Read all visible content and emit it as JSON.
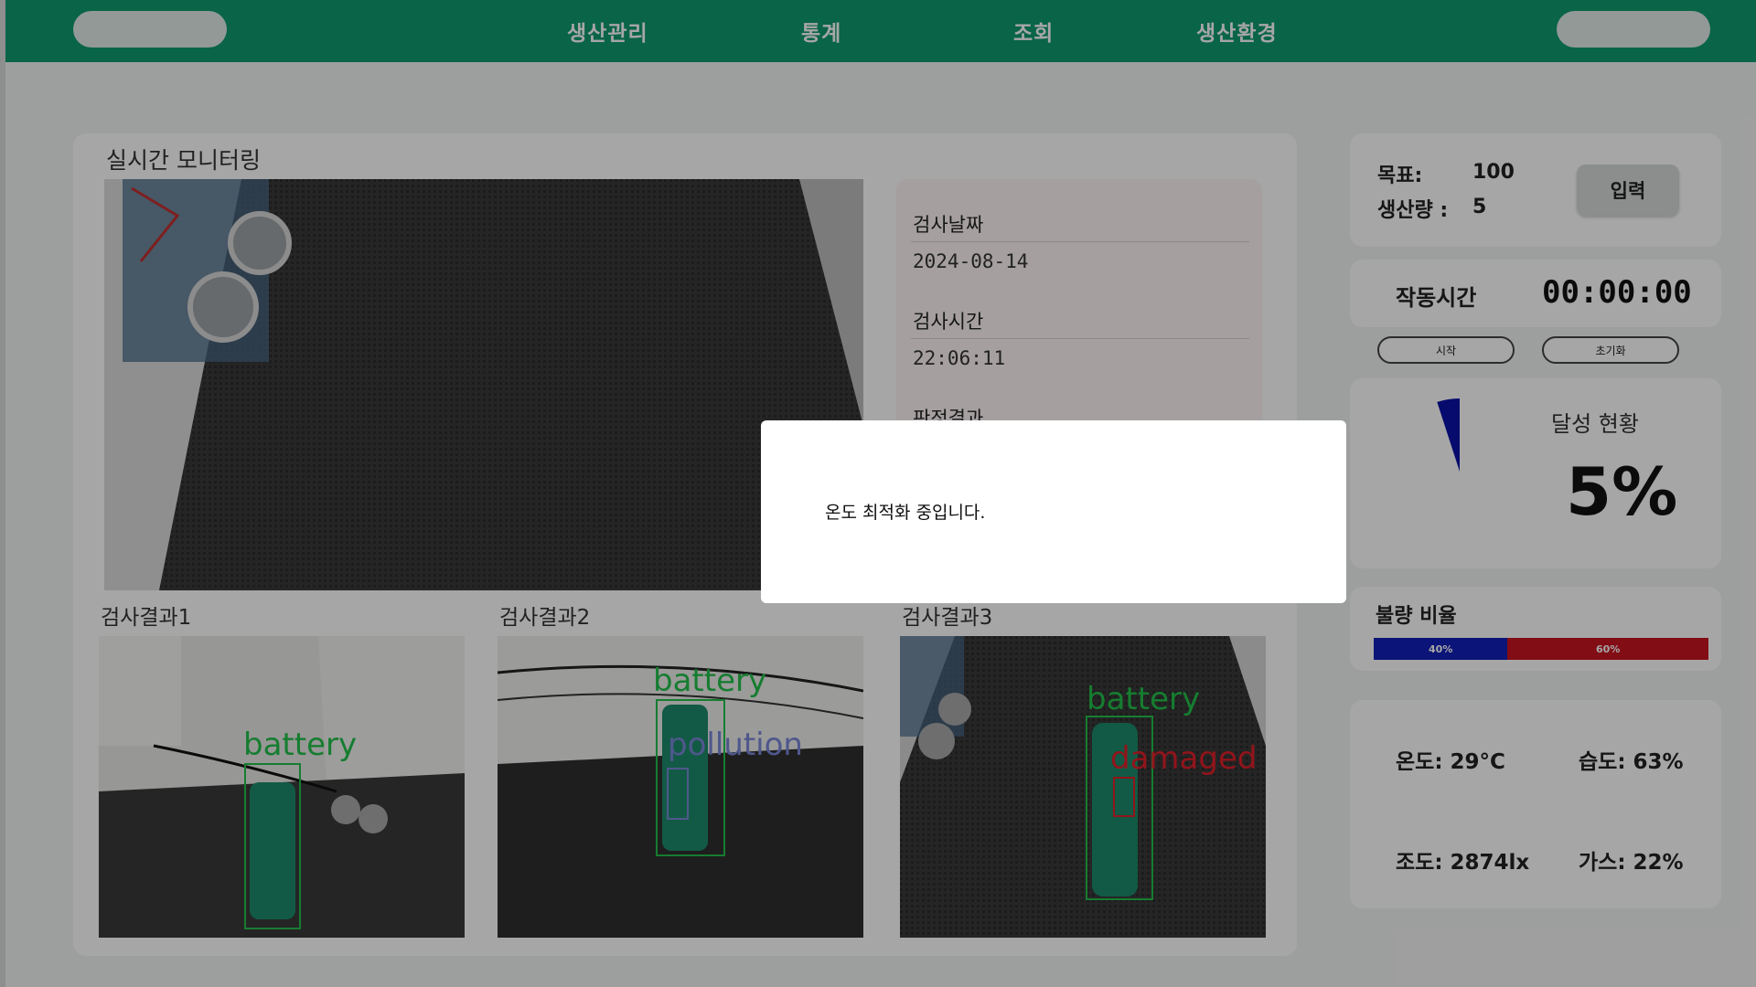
{
  "nav": {
    "items": [
      "생산관리",
      "통계",
      "조회",
      "생산환경"
    ]
  },
  "monitoring": {
    "title": "실시간 모니터링",
    "info": {
      "date_label": "검사날짜",
      "date_value": "2024-08-14",
      "time_label": "검사시간",
      "time_value": "22:06:11",
      "result_label": "판정결과"
    },
    "results": [
      {
        "label": "검사결과1",
        "detections": [
          "battery"
        ]
      },
      {
        "label": "검사결과2",
        "detections": [
          "battery",
          "pollution"
        ]
      },
      {
        "label": "검사결과3",
        "detections": [
          "battery",
          "damaged"
        ]
      }
    ]
  },
  "goal": {
    "target_label": "목표:",
    "target_value": "100",
    "produced_label": "생산량 :",
    "produced_value": "5",
    "input_button": "입력"
  },
  "runtime": {
    "label": "작동시간",
    "value": "00:00:00",
    "start_button": "시작",
    "reset_button": "초기화"
  },
  "achievement": {
    "title": "달성 현황",
    "value": "5%",
    "fraction": 0.05
  },
  "defect": {
    "title": "불량 비율",
    "segments": [
      {
        "label": "40%",
        "percent": 40,
        "color": "#1220b8"
      },
      {
        "label": "60%",
        "percent": 60,
        "color": "#c81420"
      }
    ]
  },
  "environment": {
    "temperature": "온도: 29°C",
    "humidity": "습도: 63%",
    "illuminance": "조도: 2874lx",
    "gas": "가스: 22%"
  },
  "modal": {
    "message": "온도 최적화 중입니다."
  },
  "colors": {
    "brand": "#0f9a6f",
    "detect_box": "#22c04a",
    "pollution_text": "#7a86d8",
    "damaged_text": "#e0202a",
    "gauge": "#0a12a8"
  }
}
